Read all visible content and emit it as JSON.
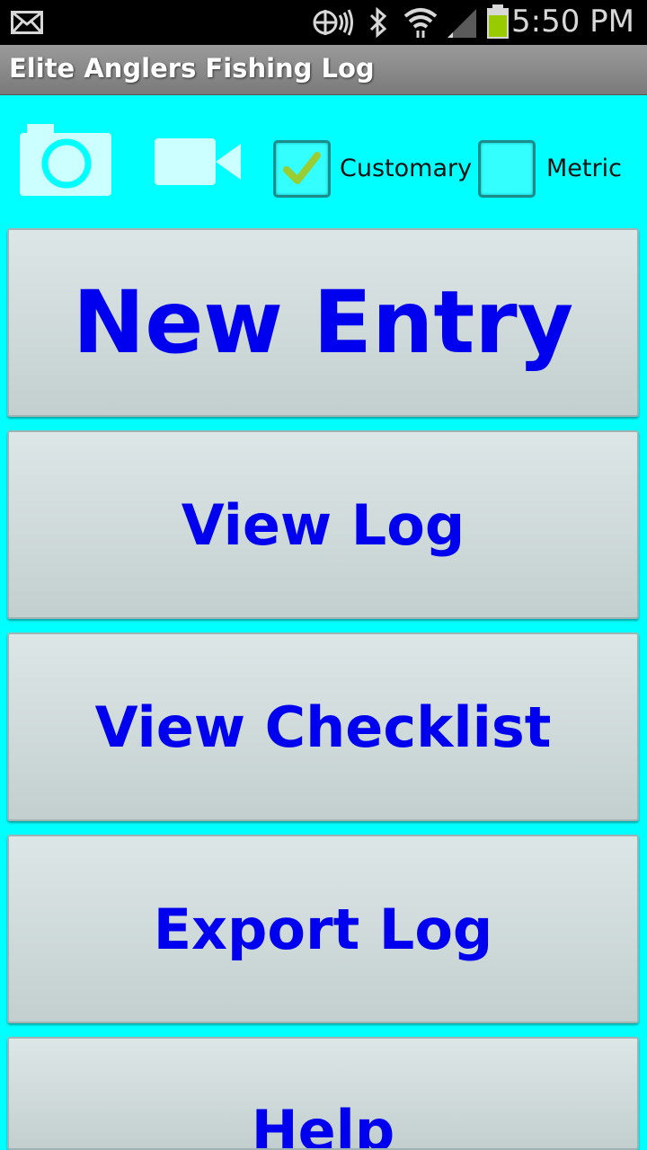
{
  "status_bar": {
    "time": "5:50 PM",
    "icons": [
      "mail-icon",
      "nfc-icon",
      "bluetooth-icon",
      "wifi-icon",
      "signal-icon",
      "battery-icon"
    ]
  },
  "app": {
    "title": "Elite Anglers Fishing Log"
  },
  "toolbar": {
    "camera_icon": "camera-icon",
    "video_icon": "video-camera-icon",
    "units": [
      {
        "label": "Customary",
        "checked": true
      },
      {
        "label": "Metric",
        "checked": false
      }
    ]
  },
  "menu": {
    "new_entry": "New Entry",
    "view_log": "View Log",
    "view_checklist": "View Checklist",
    "export_log": "Export Log",
    "help": "Help"
  },
  "colors": {
    "background": "#00ffff",
    "button_text": "#0000ee",
    "check_mark": "#9acd32"
  }
}
